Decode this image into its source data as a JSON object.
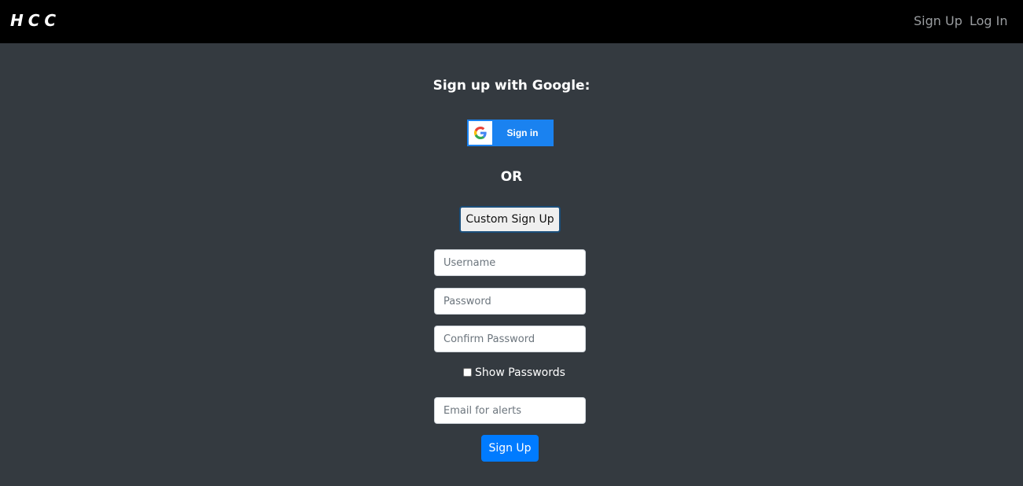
{
  "navbar": {
    "brand": "HCC",
    "links": [
      {
        "label": "Sign Up"
      },
      {
        "label": "Log In"
      }
    ]
  },
  "main": {
    "heading": "Sign up with Google:",
    "google_button": {
      "label": "Sign in",
      "icon": "google-logo-icon"
    },
    "separator": "OR",
    "custom_button": "Custom Sign Up",
    "fields": {
      "username": {
        "value": "",
        "placeholder": "Username"
      },
      "password": {
        "value": "",
        "placeholder": "Password"
      },
      "confirm_password": {
        "value": "",
        "placeholder": "Confirm Password"
      },
      "email": {
        "value": "",
        "placeholder": "Email for alerts"
      }
    },
    "show_passwords": {
      "label": "Show Passwords",
      "checked": false
    },
    "submit": "Sign Up"
  },
  "colors": {
    "page_bg": "#343a40",
    "navbar_bg": "#000000",
    "primary": "#007bff",
    "google_blue": "#1a82f0"
  }
}
